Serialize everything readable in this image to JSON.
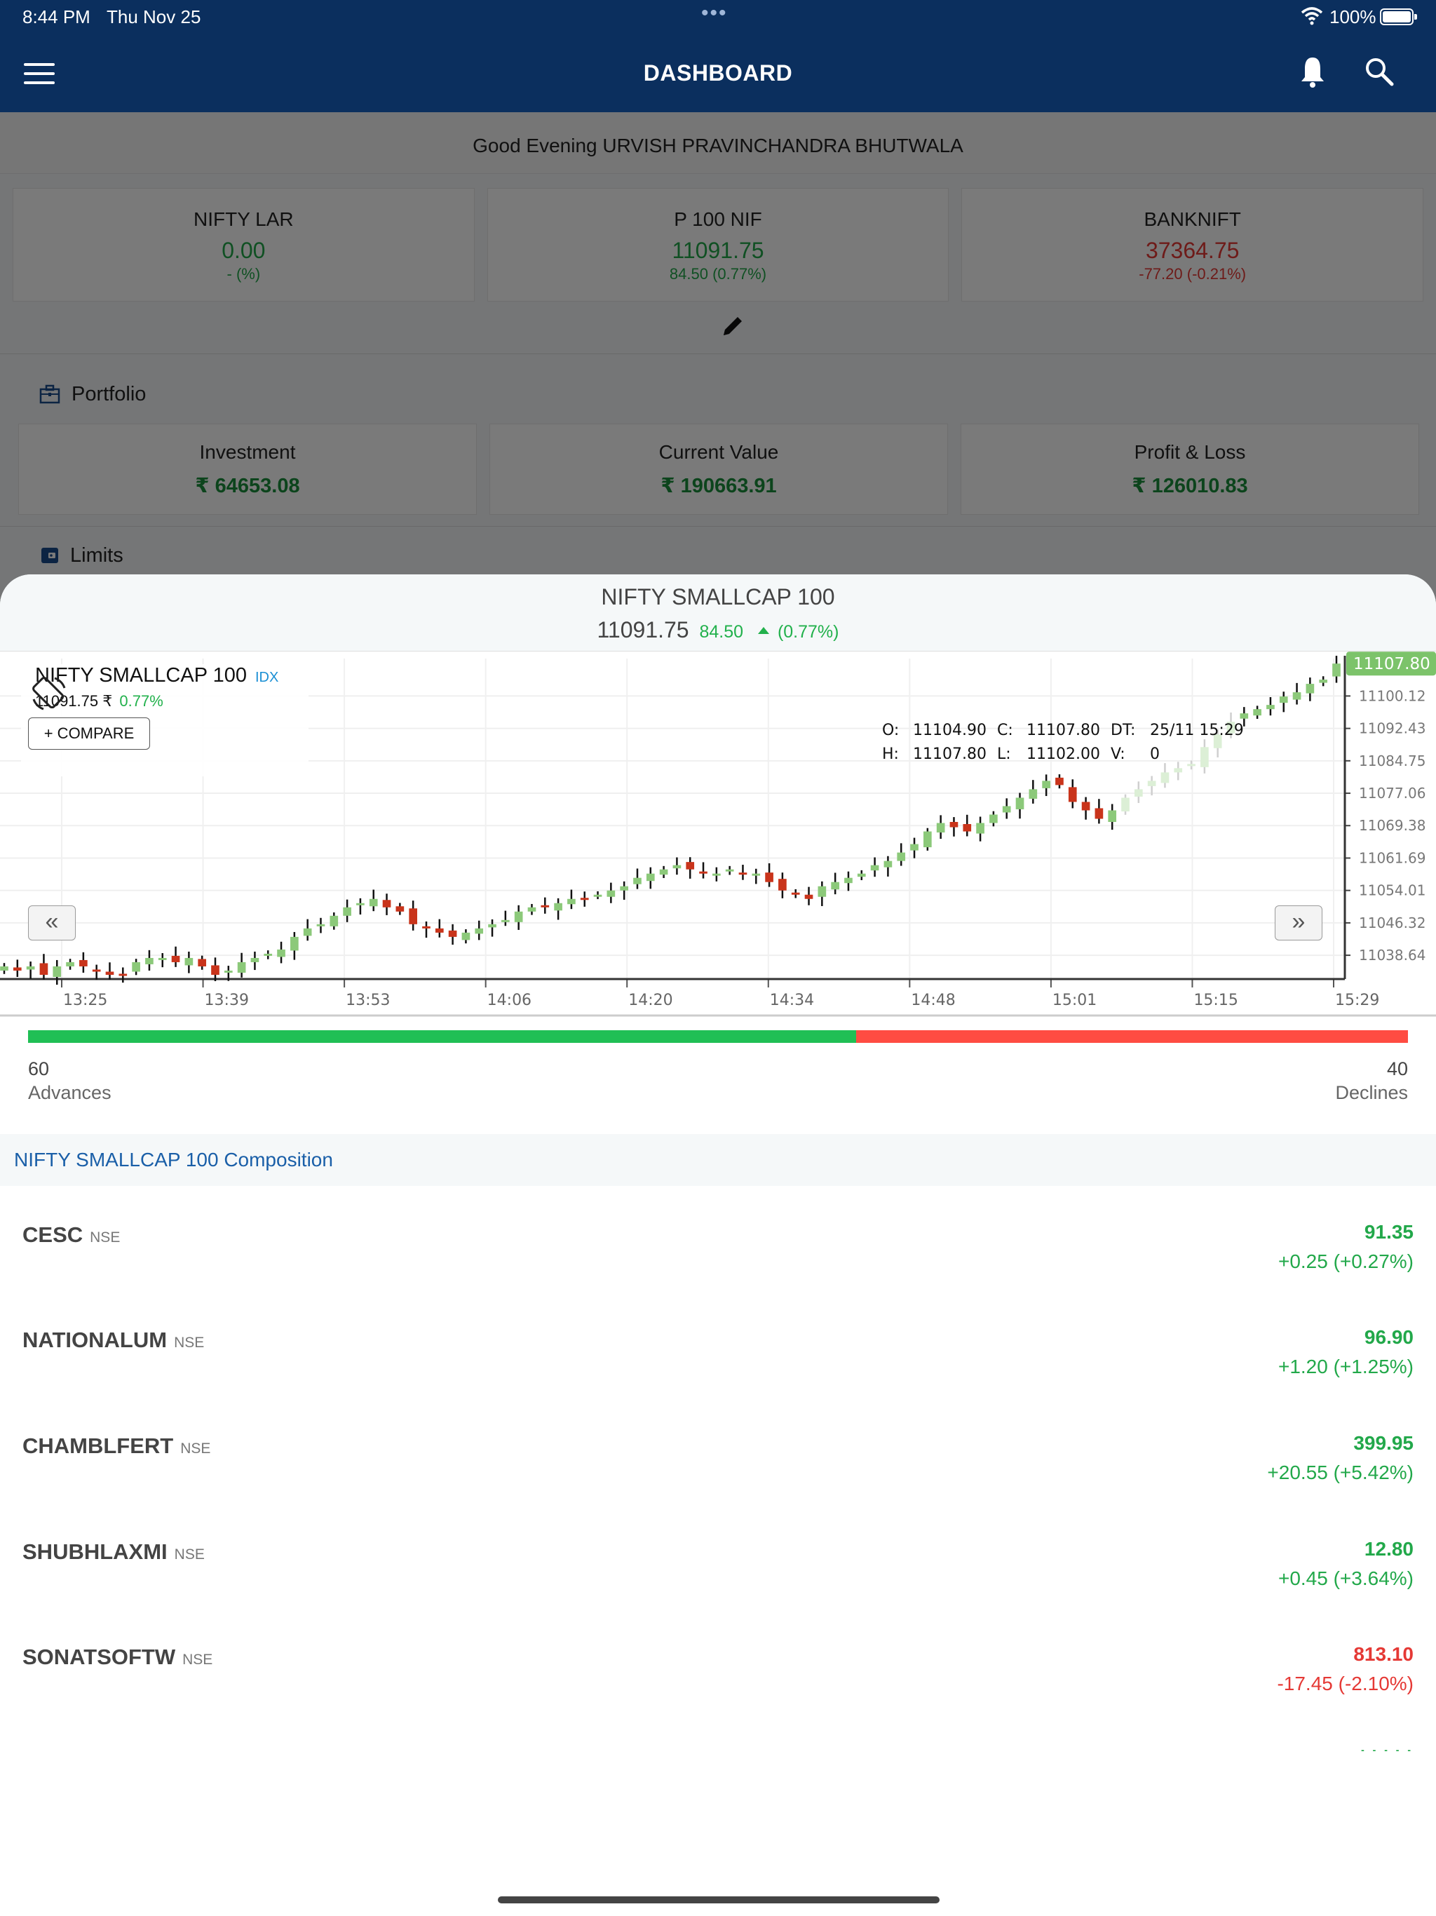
{
  "status_bar": {
    "time": "8:44 PM",
    "date": "Thu Nov 25",
    "battery": "100%",
    "icons": [
      "wifi-icon",
      "battery-icon",
      "multitasking-dots-icon"
    ]
  },
  "navbar": {
    "title": "DASHBOARD",
    "menu_icon": "hamburger-menu-icon",
    "bell_icon": "bell-icon",
    "search_icon": "search-icon"
  },
  "greeting": "Good Evening URVISH PRAVINCHANDRA BHUTWALA",
  "indices": [
    {
      "name": "NIFTY LAR",
      "value": "0.00",
      "change": "-  (%)",
      "trend": "up"
    },
    {
      "name": "P 100     NIF",
      "value": "11091.75",
      "change": "84.50  (0.77%)",
      "trend": "up"
    },
    {
      "name": "BANKNIFT",
      "value": "37364.75",
      "change": "-77.20  (-0.21%)",
      "trend": "down"
    }
  ],
  "edit_icon": "pencil-icon",
  "portfolio": {
    "title": "Portfolio",
    "cards": [
      {
        "label": "Investment",
        "value": "₹ 64653.08"
      },
      {
        "label": "Current Value",
        "value": "₹ 190663.91"
      },
      {
        "label": "Profit & Loss",
        "value": "₹ 126010.83"
      }
    ]
  },
  "limits": {
    "title": "Limits"
  },
  "sheet": {
    "title": "NIFTY SMALLCAP 100",
    "price": "11091.75",
    "change": "84.50",
    "change_pct": "(0.77%)",
    "chart_overlay": {
      "name": "NIFTY SMALLCAP 100",
      "badge": "IDX",
      "price": "11091.75 ₹",
      "pct": "0.77%",
      "compare_label": "+ COMPARE",
      "ohlc": {
        "o_label": "O:",
        "o": "11104.90",
        "c_label": "C:",
        "c": "11107.80",
        "dt_label": "DT:",
        "dt": "25/11 15:29",
        "h_label": "H:",
        "h": "11107.80",
        "l_label": "L:",
        "l": "11102.00",
        "v_label": "V:",
        "v": "0"
      },
      "last_price_tag": "11107.80",
      "nav_left": "«",
      "nav_right": "»"
    },
    "advances": {
      "count": "60",
      "label": "Advances",
      "fraction": 0.6
    },
    "declines": {
      "count": "40",
      "label": "Declines",
      "fraction": 0.4
    },
    "composition_title": "NIFTY SMALLCAP 100 Composition",
    "composition": [
      {
        "symbol": "CESC",
        "exchange": "NSE",
        "ltp": "91.35",
        "change": "+0.25 (+0.27%)",
        "trend": "up"
      },
      {
        "symbol": "NATIONALUM",
        "exchange": "NSE",
        "ltp": "96.90",
        "change": "+1.20 (+1.25%)",
        "trend": "up"
      },
      {
        "symbol": "CHAMBLFERT",
        "exchange": "NSE",
        "ltp": "399.95",
        "change": "+20.55 (+5.42%)",
        "trend": "up"
      },
      {
        "symbol": "SHUBHLAXMI",
        "exchange": "NSE",
        "ltp": "12.80",
        "change": "+0.45 (+3.64%)",
        "trend": "up"
      },
      {
        "symbol": "SONATSOFTW",
        "exchange": "NSE",
        "ltp": "813.10",
        "change": "-17.45 (-2.10%)",
        "trend": "down"
      }
    ]
  },
  "colors": {
    "navy": "#0b2f5e",
    "up_green": "#22b14c",
    "down_red": "#e53935",
    "candle_up": "#8cc97a",
    "candle_down": "#c9341b",
    "advance_bar": "#20bf55",
    "decline_bar": "#ff4c42",
    "link_blue": "#1a5fa8"
  },
  "chart_data": {
    "type": "candlestick",
    "title": "NIFTY SMALLCAP 100",
    "xlabel": "",
    "ylabel": "",
    "x_ticks": [
      "13:25",
      "13:39",
      "13:53",
      "14:06",
      "14:20",
      "14:34",
      "14:48",
      "15:01",
      "15:15",
      "15:29"
    ],
    "y_ticks": [
      "11100.12",
      "11092.43",
      "11084.75",
      "11077.06",
      "11069.38",
      "11061.69",
      "11054.01",
      "11046.32",
      "11038.64"
    ],
    "ylim": [
      11033.0,
      11109.0
    ],
    "grid": true,
    "last_price": 11107.8,
    "close_series": [
      11036,
      11035,
      11036,
      11034,
      11036,
      11037,
      11036,
      11035,
      11034,
      11034,
      11037,
      11038,
      11038,
      11037,
      11038,
      11036,
      11034,
      11035,
      11037,
      11038,
      11039,
      11040,
      11043,
      11045,
      11046,
      11048,
      11050,
      11051,
      11052,
      11050,
      11049,
      11046,
      11045,
      11044,
      11043,
      11044,
      11045,
      11046,
      11047,
      11049,
      11050,
      11050,
      11051,
      11052,
      11052,
      11053,
      11054,
      11055,
      11057,
      11058,
      11059,
      11060,
      11059,
      11058,
      11058,
      11059,
      11058,
      11058,
      11056,
      11054,
      11053,
      11052,
      11055,
      11056,
      11057,
      11058,
      11060,
      11061,
      11063,
      11065,
      11068,
      11070,
      11069,
      11068,
      11070,
      11072,
      11074,
      11076,
      11078,
      11080,
      11079,
      11075,
      11073,
      11071,
      11073,
      11076,
      11078,
      11080,
      11082,
      11083,
      11084,
      11088,
      11091,
      11094,
      11096,
      11097,
      11098,
      11100,
      11101,
      11103,
      11104,
      11107.8
    ],
    "bands_note": "candles estimated from visual; last candle O 11104.90 H 11107.80 L 11102.00 C 11107.80"
  }
}
